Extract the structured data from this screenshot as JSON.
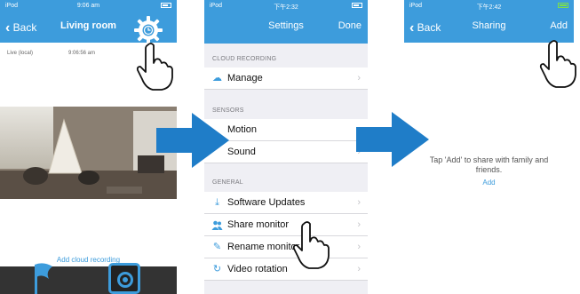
{
  "colors": {
    "accent": "#3d9cdc",
    "background": "#efeff4",
    "arrow": "#1f7dc8"
  },
  "screen1": {
    "status": {
      "carrier": "iPod",
      "time": "9:06 am"
    },
    "nav": {
      "back_label": "Back",
      "title": "Living room"
    },
    "gear_icon": "settings-gear-icon",
    "list": {
      "name": "Live (local)",
      "time": "9:06:56 am"
    },
    "add_cloud_label": "Add cloud recording",
    "bottom_icons": [
      "flag-icon",
      "camera-icon"
    ]
  },
  "screen2": {
    "status": {
      "carrier": "iPod",
      "time": "下午2:32"
    },
    "nav": {
      "title": "Settings",
      "done_label": "Done"
    },
    "sections": [
      {
        "header": "CLOUD RECORDING",
        "rows": [
          {
            "label": "Manage",
            "icon": "cloud-icon"
          }
        ]
      },
      {
        "header": "SENSORS",
        "rows": [
          {
            "label": "Motion",
            "icon": ""
          },
          {
            "label": "Sound",
            "icon": ""
          }
        ]
      },
      {
        "header": "GENERAL",
        "rows": [
          {
            "label": "Software Updates",
            "icon": "download-icon"
          },
          {
            "label": "Share monitor",
            "icon": "users-icon"
          },
          {
            "label": "Rename monitor",
            "icon": "pencil-icon"
          },
          {
            "label": "Video rotation",
            "icon": "rotate-icon"
          }
        ]
      }
    ]
  },
  "screen3": {
    "status": {
      "carrier": "iPod",
      "time": "下午2:42"
    },
    "nav": {
      "back_label": "Back",
      "title": "Sharing",
      "add_label": "Add"
    },
    "message_line1": "Tap 'Add' to share with family and",
    "message_line2": "friends.",
    "add_link": "Add"
  }
}
